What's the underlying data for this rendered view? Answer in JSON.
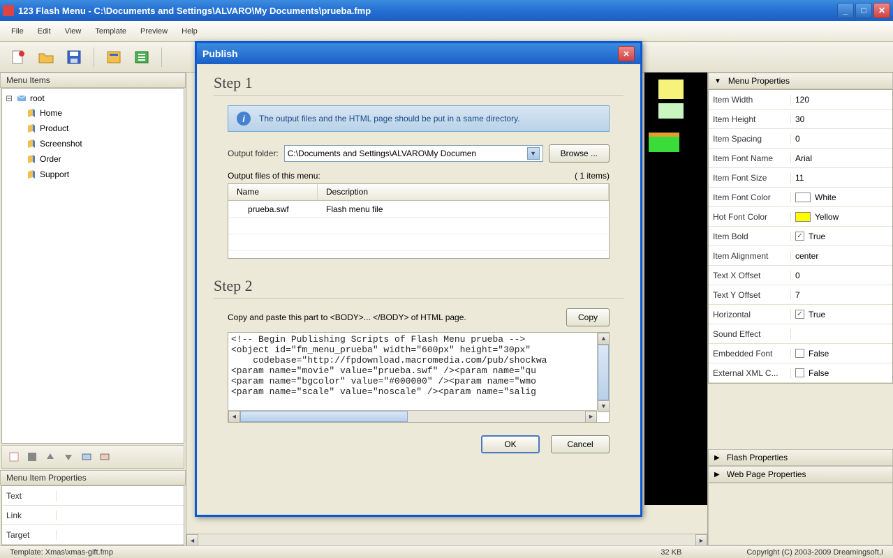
{
  "window": {
    "title": "123 Flash Menu - C:\\Documents and Settings\\ALVARO\\My Documents\\prueba.fmp"
  },
  "menubar": [
    "File",
    "Edit",
    "View",
    "Template",
    "Preview",
    "Help"
  ],
  "left": {
    "header": "Menu Items",
    "root_label": "root",
    "items": [
      "Home",
      "Product",
      "Screenshot",
      "Order",
      "Support"
    ],
    "props_header": "Menu Item Properties",
    "prop_keys": [
      "Text",
      "Link",
      "Target"
    ]
  },
  "right": {
    "sections": {
      "menu": "Menu Properties",
      "flash": "Flash Properties",
      "web": "Web Page Properties"
    },
    "props": [
      {
        "k": "Item Width",
        "v": "120"
      },
      {
        "k": "Item Height",
        "v": "30"
      },
      {
        "k": "Item Spacing",
        "v": "0"
      },
      {
        "k": "Item Font Name",
        "v": "Arial"
      },
      {
        "k": "Item Font Size",
        "v": "11"
      },
      {
        "k": "Item Font Color",
        "v": "White",
        "swatch": "#ffffff"
      },
      {
        "k": "Hot Font Color",
        "v": "Yellow",
        "swatch": "#ffff00"
      },
      {
        "k": "Item Bold",
        "v": "True",
        "check": true
      },
      {
        "k": "Item Alignment",
        "v": "center"
      },
      {
        "k": "Text X Offset",
        "v": "0"
      },
      {
        "k": "Text Y Offset",
        "v": "7"
      },
      {
        "k": "Horizontal",
        "v": "True",
        "check": true
      },
      {
        "k": "Sound Effect",
        "v": ""
      },
      {
        "k": "Embedded Font",
        "v": "False",
        "check": false
      },
      {
        "k": "External XML C...",
        "v": "False",
        "check": false
      }
    ]
  },
  "dialog": {
    "title": "Publish",
    "step1": "Step 1",
    "info": "The output files and the HTML page should be put in a same directory.",
    "output_label": "Output folder:",
    "output_path": "C:\\Documents and Settings\\ALVARO\\My Documen",
    "browse": "Browse ...",
    "files_label": "Output files of this menu:",
    "files_count": "( 1 items)",
    "table": {
      "cols": [
        "Name",
        "Description"
      ],
      "rows": [
        [
          "prueba.swf",
          "Flash menu file"
        ]
      ]
    },
    "step2": "Step 2",
    "copy_label": "Copy and paste this part to <BODY>... </BODY> of HTML page.",
    "copy_btn": "Copy",
    "code": "<!-- Begin Publishing Scripts of Flash Menu prueba -->\n<object id=\"fm_menu_prueba\" width=\"600px\" height=\"30px\" \n    codebase=\"http://fpdownload.macromedia.com/pub/shockwa\n<param name=\"movie\" value=\"prueba.swf\" /><param name=\"qu\n<param name=\"bgcolor\" value=\"#000000\" /><param name=\"wmo\n<param name=\"scale\" value=\"noscale\" /><param name=\"salig",
    "ok": "OK",
    "cancel": "Cancel"
  },
  "status": {
    "template": "Template:  Xmas\\xmas-gift.fmp",
    "size": "32 KB",
    "copyright": "Copyright (C) 2003-2009 Dreamingsoft,I"
  }
}
